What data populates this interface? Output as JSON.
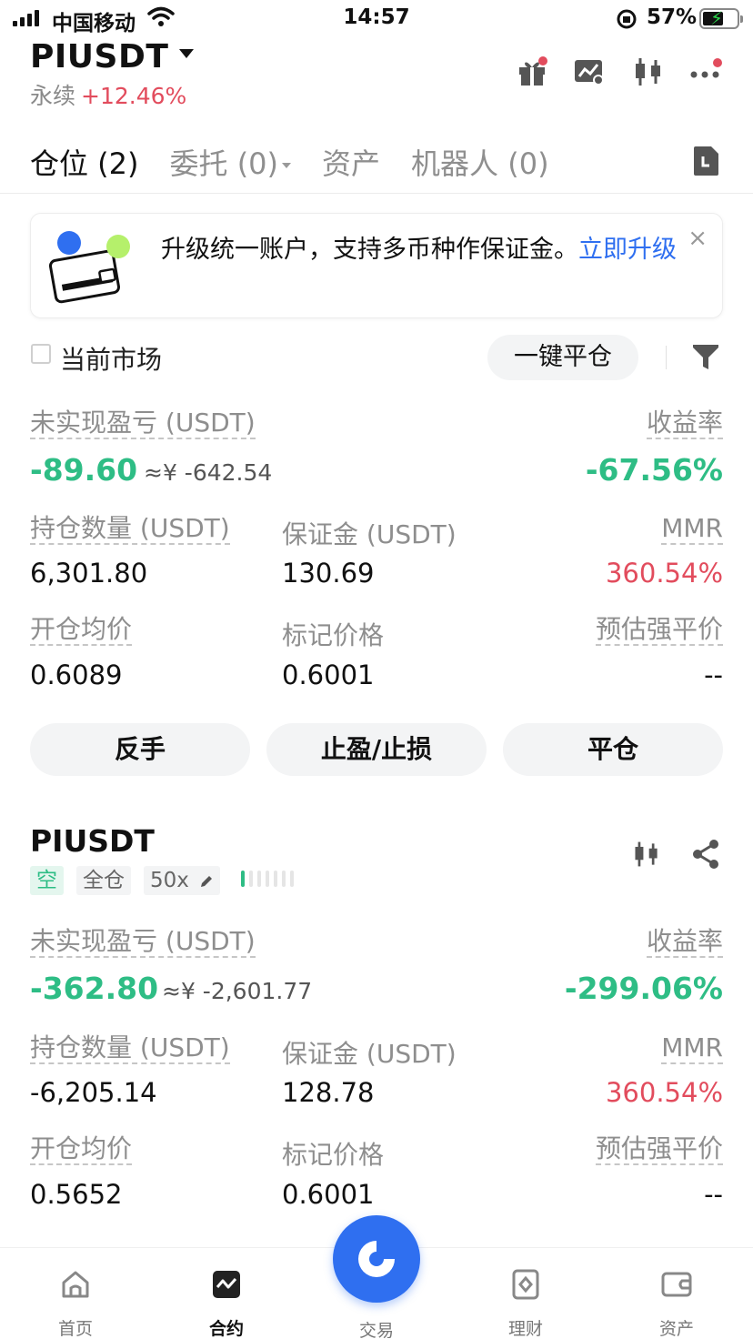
{
  "status_bar": {
    "carrier": "中国移动",
    "time": "14:57",
    "battery": "57%"
  },
  "header": {
    "pair": "PIUSDT",
    "type": "永续",
    "change": "+12.46%"
  },
  "tabs": [
    "仓位 (2)",
    "委托 (0)",
    "资产",
    "机器人 (0)"
  ],
  "banner": {
    "text": "升级统一账户，支持多币种作保证金。",
    "link": "立即升级",
    "close": "×"
  },
  "filter": {
    "current_market": "当前市场",
    "close_all": "一键平仓"
  },
  "labels": {
    "upnl": "未实现盈亏 (USDT)",
    "roe": "收益率",
    "size": "持仓数量 (USDT)",
    "margin": "保证金 (USDT)",
    "mmr": "MMR",
    "entry": "开仓均价",
    "mark": "标记价格",
    "liq": "预估强平价"
  },
  "positions": [
    {
      "upnl": "-89.60",
      "upnl_cny": "≈¥ -642.54",
      "roe": "-67.56%",
      "size": "6,301.80",
      "margin": "130.69",
      "mmr": "360.54%",
      "entry": "0.6089",
      "mark": "0.6001",
      "liq": "--"
    },
    {
      "symbol": "PIUSDT",
      "side": "空",
      "mode": "全仓",
      "leverage": "50x",
      "upnl": "-362.80",
      "upnl_cny": "≈¥ -2,601.77",
      "roe": "-299.06%",
      "size": "-6,205.14",
      "margin": "128.78",
      "mmr": "360.54%",
      "entry": "0.5652",
      "mark": "0.6001",
      "liq": "--"
    }
  ],
  "actions": {
    "reverse": "反手",
    "tpsl": "止盈/止损",
    "close": "平仓"
  },
  "nav": {
    "home": "首页",
    "futures": "合约",
    "trade": "交易",
    "earn": "理财",
    "assets": "资产"
  },
  "colors": {
    "profit_green": "#2ebd85",
    "loss_red": "#e24c5d",
    "accent_blue": "#2f6ff0"
  }
}
